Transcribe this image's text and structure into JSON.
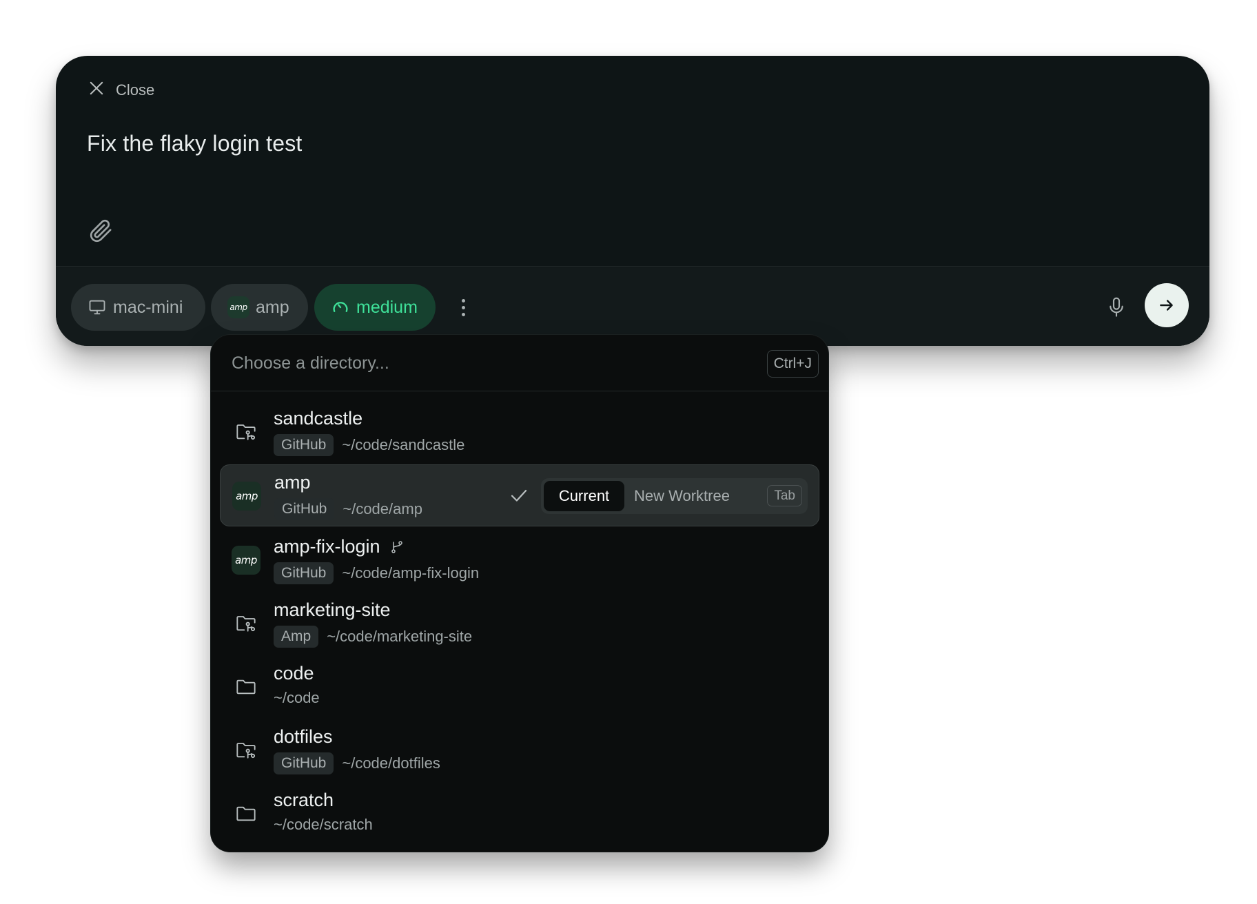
{
  "composer": {
    "close_label": "Close",
    "prompt_text": "Fix the flaky login test"
  },
  "toolbar": {
    "host_label": "mac-mini",
    "repo_label": "amp",
    "effort_label": "medium",
    "amp_logo_text": "amp"
  },
  "dropdown": {
    "search_placeholder": "Choose a directory...",
    "shortcut": "Ctrl+J",
    "items": [
      {
        "name": "sandcastle",
        "badge": "GitHub",
        "path": "~/code/sandcastle",
        "icon": "folder-git-icon"
      },
      {
        "name": "amp",
        "badge": "GitHub",
        "path": "~/code/amp",
        "icon": "amp-logo",
        "selected": true
      },
      {
        "name": "amp-fix-login",
        "badge": "GitHub",
        "path": "~/code/amp-fix-login",
        "icon": "amp-logo",
        "worktree": true
      },
      {
        "name": "marketing-site",
        "badge": "Amp",
        "path": "~/code/marketing-site",
        "icon": "folder-git-icon"
      },
      {
        "name": "code",
        "badge": "",
        "path": "~/code",
        "icon": "folder-icon"
      },
      {
        "name": "dotfiles",
        "badge": "GitHub",
        "path": "~/code/dotfiles",
        "icon": "folder-git-icon"
      },
      {
        "name": "scratch",
        "badge": "",
        "path": "~/code/scratch",
        "icon": "folder-icon"
      }
    ],
    "worktree_options": {
      "current_label": "Current",
      "new_label": "New Worktree",
      "tab_hint": "Tab"
    }
  },
  "colors": {
    "panel_bg": "#0e1516",
    "effort_accent": "#3fe29a",
    "send_button_bg": "#eaf2ee"
  }
}
